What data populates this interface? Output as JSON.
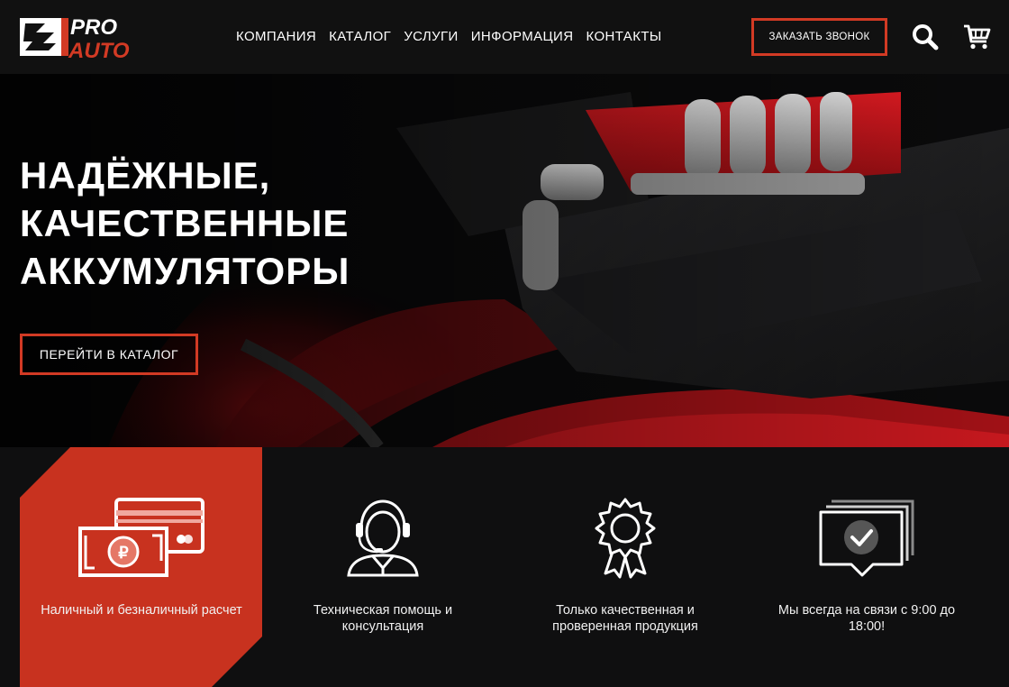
{
  "brand": {
    "top": "PRO",
    "bottom": "AUTO"
  },
  "nav": {
    "items": [
      {
        "label": "КОМПАНИЯ"
      },
      {
        "label": "КАТАЛОГ"
      },
      {
        "label": "УСЛУГИ"
      },
      {
        "label": "ИНФОРМАЦИЯ"
      },
      {
        "label": "КОНТАКТЫ"
      }
    ]
  },
  "header": {
    "call_label": "ЗАКАЗАТЬ ЗВОНОК"
  },
  "hero": {
    "title_lines": [
      "НАДЁЖНЫЕ,",
      "КАЧЕСТВЕННЫЕ",
      "АККУМУЛЯТОРЫ"
    ],
    "cta_label": "ПЕРЕЙТИ В КАТАЛОГ"
  },
  "features": [
    {
      "icon": "payment-cards-icon",
      "text": "Наличный и безналичный расчет"
    },
    {
      "icon": "support-operator-icon",
      "text": "Техническая помощь и консультация"
    },
    {
      "icon": "quality-badge-icon",
      "text": "Только качественная и проверенная продукция"
    },
    {
      "icon": "message-check-icon",
      "text": "Мы всегда на связи с 9:00 до 18:00!"
    }
  ],
  "colors": {
    "accent": "#d23a24",
    "background": "#0f0f10",
    "header": "#111111"
  }
}
